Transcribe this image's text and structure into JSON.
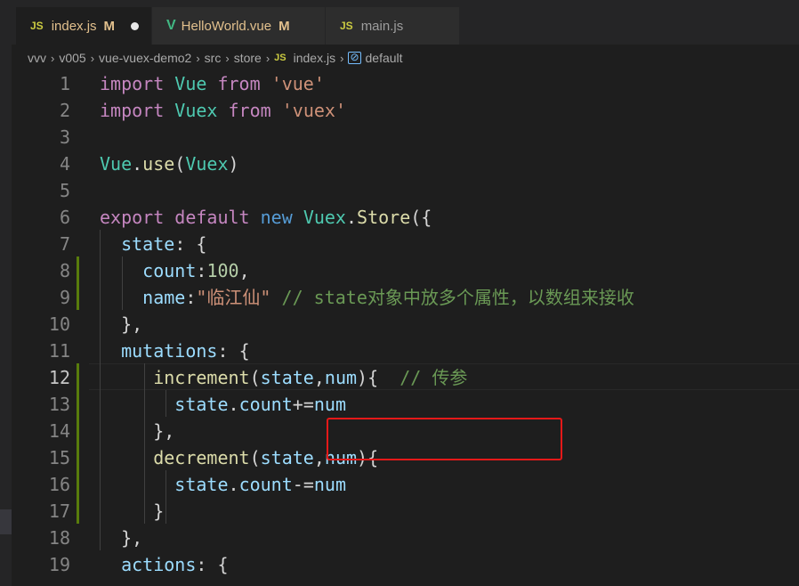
{
  "tabs": [
    {
      "icon": "JS",
      "label": "index.js",
      "status": "M",
      "active": true,
      "dirty": true
    },
    {
      "icon": "V",
      "label": "HelloWorld.vue",
      "status": "M",
      "active": false
    },
    {
      "icon": "JS",
      "label": "main.js",
      "status": "",
      "active": false
    }
  ],
  "breadcrumb": {
    "parts": [
      "vvv",
      "v005",
      "vue-vuex-demo2",
      "src",
      "store"
    ],
    "file_icon": "JS",
    "file": "index.js",
    "symbol_icon": "[⊘]",
    "symbol": "default"
  },
  "current_line": 12,
  "code_lines": [
    {
      "n": "1",
      "text": "import Vue from 'vue'"
    },
    {
      "n": "2",
      "text": "import Vuex from 'vuex'"
    },
    {
      "n": "3",
      "text": ""
    },
    {
      "n": "4",
      "text": "Vue.use(Vuex)"
    },
    {
      "n": "5",
      "text": ""
    },
    {
      "n": "6",
      "text": "export default new Vuex.Store({"
    },
    {
      "n": "7",
      "text": "  state: {"
    },
    {
      "n": "8",
      "text": "    count:100,"
    },
    {
      "n": "9",
      "text": "    name:\"临江仙\" // state对象中放多个属性，以数组来接收"
    },
    {
      "n": "10",
      "text": "  },"
    },
    {
      "n": "11",
      "text": "  mutations: {"
    },
    {
      "n": "12",
      "text": "     increment(state,num){  // 传参"
    },
    {
      "n": "13",
      "text": "       state.count+=num"
    },
    {
      "n": "14",
      "text": "     },"
    },
    {
      "n": "15",
      "text": "     decrement(state,num){"
    },
    {
      "n": "16",
      "text": "       state.count-=num"
    },
    {
      "n": "17",
      "text": "     }"
    },
    {
      "n": "18",
      "text": "  },"
    },
    {
      "n": "19",
      "text": "  actions: {"
    }
  ],
  "colors": {
    "background": "#1e1e1e",
    "keyword": "#c586c0",
    "string": "#ce9178",
    "class": "#4ec9b0",
    "function": "#dcdcaa",
    "variable": "#9cdcfe",
    "number": "#b5cea8",
    "comment": "#6a9955",
    "annotation_box": "#e51919",
    "modified_gutter": "#587c0c"
  }
}
